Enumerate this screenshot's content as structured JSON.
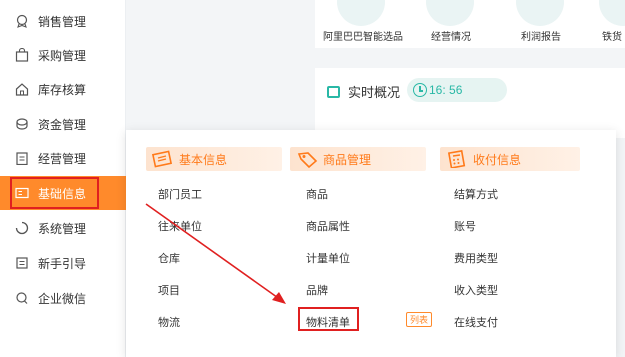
{
  "sidebar": {
    "items": [
      {
        "label": "销售管理",
        "icon": "trophy-icon"
      },
      {
        "label": "采购管理",
        "icon": "bag-icon"
      },
      {
        "label": "库存核算",
        "icon": "house-icon"
      },
      {
        "label": "资金管理",
        "icon": "money-icon"
      },
      {
        "label": "经营管理",
        "icon": "clipboard-icon"
      },
      {
        "label": "基础信息",
        "icon": "idcard-icon"
      },
      {
        "label": "系统管理",
        "icon": "loading-icon"
      },
      {
        "label": "新手引导",
        "icon": "guide-icon"
      },
      {
        "label": "企业微信",
        "icon": "chat-icon"
      }
    ]
  },
  "quick": {
    "items": [
      {
        "label": "阿里巴巴智能选品"
      },
      {
        "label": "经营情况"
      },
      {
        "label": "利润报告"
      },
      {
        "label": "铁货"
      }
    ]
  },
  "realtime": {
    "title": "实时概况",
    "time": "16: 56"
  },
  "panel": {
    "basic": {
      "title": "基本信息",
      "links": [
        "部门员工",
        "往来单位",
        "仓库",
        "项目",
        "物流"
      ]
    },
    "goods": {
      "title": "商品管理",
      "links": [
        "商品",
        "商品属性",
        "计量单位",
        "品牌",
        "物料清单"
      ],
      "tag": "列表"
    },
    "payment": {
      "title": "收付信息",
      "links": [
        "结算方式",
        "账号",
        "费用类型",
        "收入类型",
        "在线支付"
      ]
    }
  },
  "colors": {
    "accent": "#ff8a2b",
    "teal": "#29b8a6",
    "highlight": "#e02020"
  }
}
